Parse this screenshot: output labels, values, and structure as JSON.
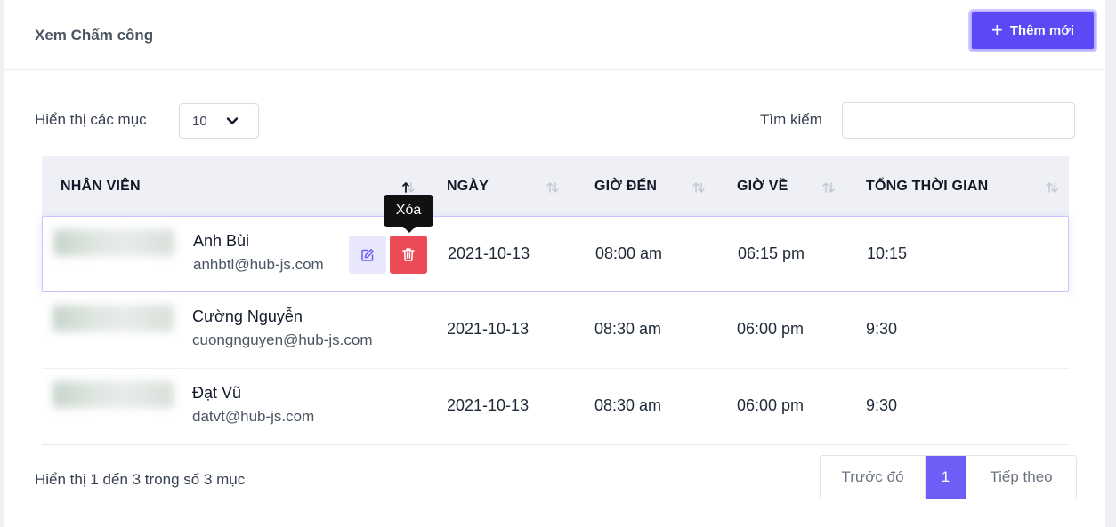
{
  "header": {
    "title": "Xem Chấm công",
    "add_label": "Thêm mới"
  },
  "controls": {
    "length_label": "Hiển thị các mục",
    "length_value": "10",
    "search_label": "Tìm kiếm",
    "search_value": ""
  },
  "table": {
    "columns": [
      "NHÂN VIÊN",
      "NGÀY",
      "GIỜ ĐẾN",
      "GIỜ VỀ",
      "TỔNG THỜI GIAN"
    ],
    "rows": [
      {
        "name": "Anh Bùi",
        "email": "anhbtl@hub-js.com",
        "date": "2021-10-13",
        "in": "08:00 am",
        "out": "06:15 pm",
        "total": "10:15"
      },
      {
        "name": "Cường Nguyễn",
        "email": "cuongnguyen@hub-js.com",
        "date": "2021-10-13",
        "in": "08:30 am",
        "out": "06:00 pm",
        "total": "9:30"
      },
      {
        "name": "Đạt Vũ",
        "email": "datvt@hub-js.com",
        "date": "2021-10-13",
        "in": "08:30 am",
        "out": "06:00 pm",
        "total": "9:30"
      }
    ],
    "tooltip": "Xóa"
  },
  "footer": {
    "info": "Hiển thị 1 đến 3 trong số 3 mục",
    "prev": "Trước đó",
    "page": "1",
    "next": "Tiếp theo"
  },
  "colors": {
    "accent": "#5b49f5",
    "danger": "#ea4b57"
  }
}
